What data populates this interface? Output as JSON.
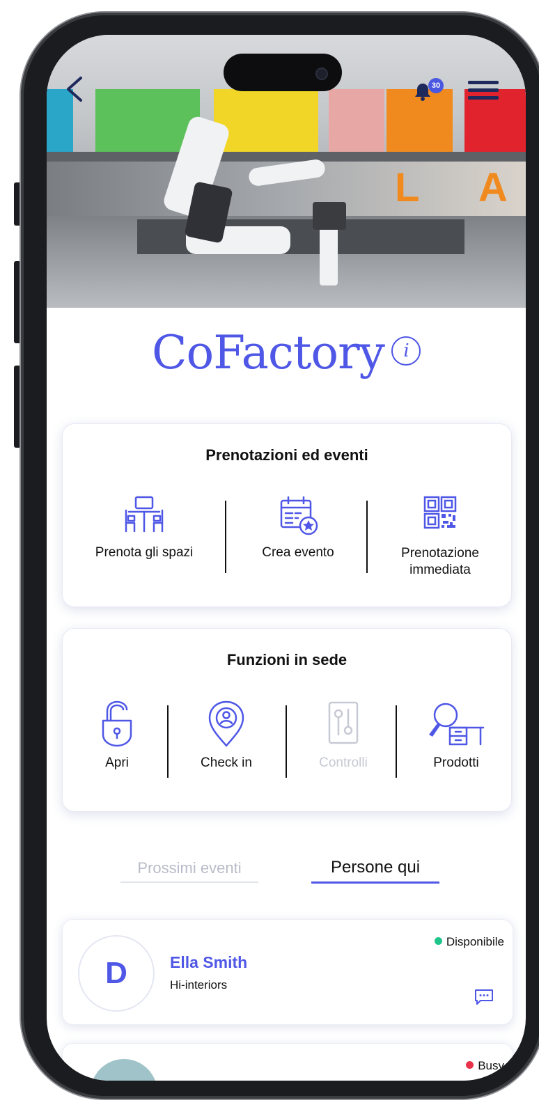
{
  "header": {
    "back_icon": "chevron-left-icon",
    "notification_icon": "bell-icon",
    "notification_count": "30",
    "menu_icon": "hamburger-menu-icon",
    "hero_letters": [
      "L",
      "A"
    ]
  },
  "brand": {
    "name": "CoFactory",
    "info_glyph": "i"
  },
  "bookings": {
    "title": "Prenotazioni ed eventi",
    "actions": [
      {
        "label": "Prenota gli spazi",
        "icon": "desk-chairs-icon"
      },
      {
        "label": "Crea evento",
        "icon": "calendar-star-icon"
      },
      {
        "label_line1": "Prenotazione",
        "label_line2": "immediata",
        "icon": "qr-code-icon"
      }
    ]
  },
  "onsite": {
    "title": "Funzioni in sede",
    "actions": [
      {
        "label": "Apri",
        "icon": "unlock-padlock-icon"
      },
      {
        "label": "Check in",
        "icon": "location-person-icon"
      },
      {
        "label": "Controlli",
        "icon": "switch-controls-icon",
        "disabled": true
      },
      {
        "label": "Prodotti",
        "icon": "search-desk-icon"
      }
    ]
  },
  "tabs": {
    "upcoming": "Prossimi eventi",
    "people": "Persone qui",
    "active": "people"
  },
  "people": [
    {
      "initial": "D",
      "name": "Ella Smith",
      "company": "Hi-interiors",
      "status": "Disponibile",
      "status_color": "#1ec48a",
      "chat_icon": "chat-bubble-icon"
    },
    {
      "status": "Busy",
      "status_color": "#e8334a"
    }
  ],
  "colors": {
    "accent": "#4f57e6",
    "available": "#1ec48a",
    "busy": "#e8334a",
    "disabled": "#c7c9d3"
  }
}
